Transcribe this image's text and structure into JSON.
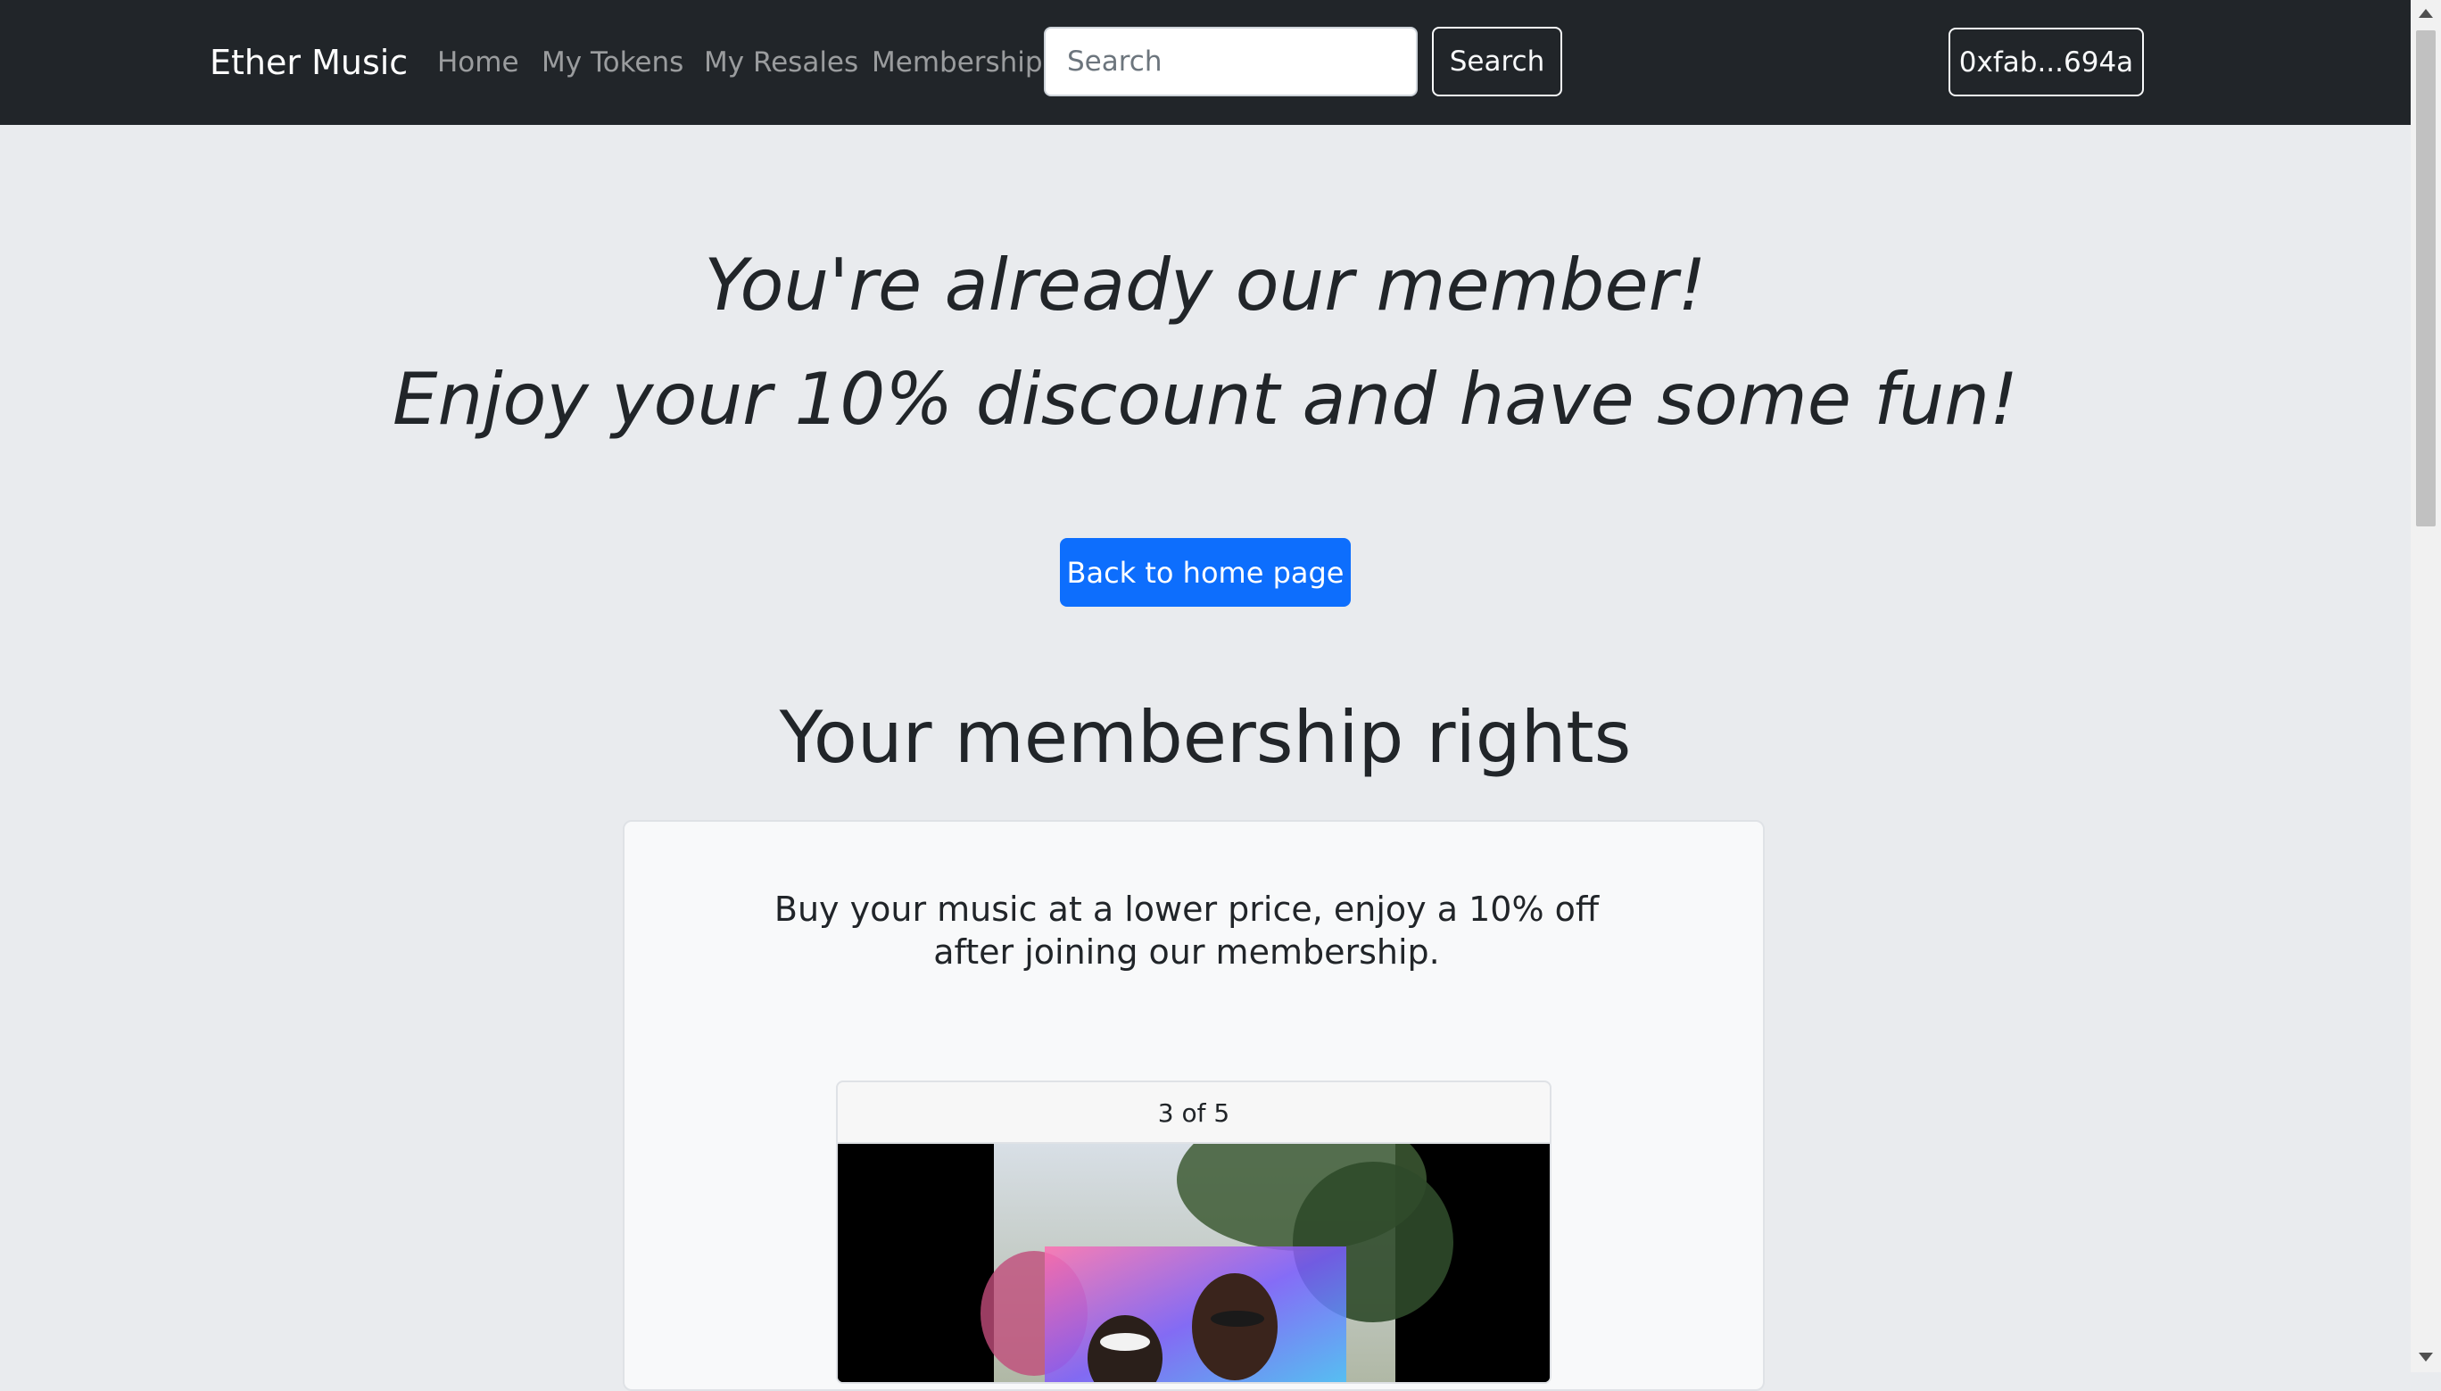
{
  "navbar": {
    "brand": "Ether Music",
    "links": [
      "Home",
      "My Tokens",
      "My Resales",
      "Membership"
    ],
    "search_placeholder": "Search",
    "search_button": "Search",
    "wallet": "0xfab...694a"
  },
  "hero": {
    "line1": "You're already our member!",
    "line2": "Enjoy your 10% discount and have some fun!",
    "button": "Back to home page"
  },
  "rights": {
    "title": "Your membership rights",
    "text": "Buy your music at a lower price, enjoy a 10% off after joining our membership.",
    "carousel": {
      "counter": "3 of 5"
    }
  },
  "colors": {
    "navbar_bg": "#212529",
    "page_bg": "#e9ebee",
    "primary": "#0d6efd"
  }
}
